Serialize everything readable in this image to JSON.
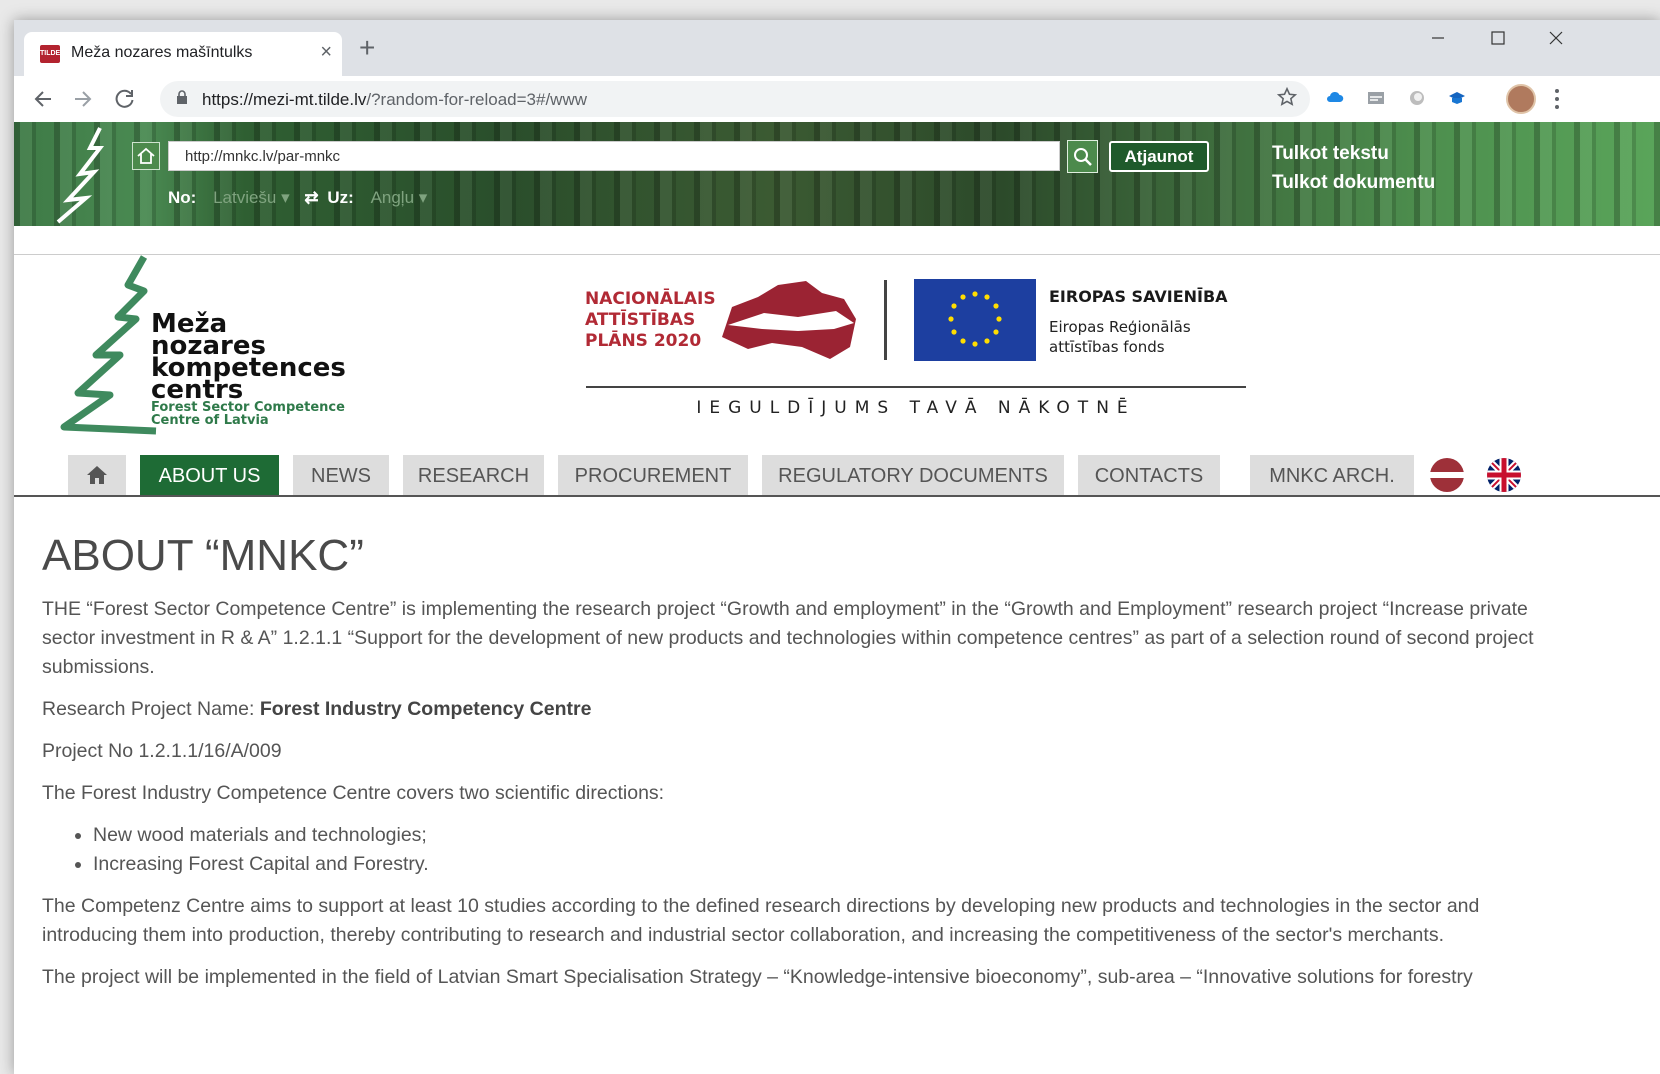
{
  "browser": {
    "tab_title": "Meža nozares mašīntulks",
    "tab_close": "×",
    "new_tab": "+",
    "url_host": "https://mezi-mt.tilde.lv",
    "url_path": "/?random-for-reload=3#/www"
  },
  "translator": {
    "url_value": "http://mnkc.lv/par-mnkc",
    "refresh_label": "Atjaunot",
    "translate_text": "Tulkot tekstu",
    "translate_doc": "Tulkot dokumentu",
    "from_label": "No:",
    "from_lang": "Latviešu",
    "to_label": "Uz:",
    "to_lang": "Angļu"
  },
  "header": {
    "logo_lines": [
      "Meža",
      "nozares",
      "kompetences",
      "centrs"
    ],
    "logo_sub": [
      "Forest Sector Competence",
      "Centre of Latvia"
    ],
    "nap_lines": [
      "NACIONĀLAIS",
      "ATTĪSTĪBAS",
      "PLĀNS 2020"
    ],
    "eu_title": "EIROPAS SAVIENĪBA",
    "eu_sub": [
      "Eiropas Reģionālās",
      "attīstības fonds"
    ],
    "motto": "IEGULDĪJUMS TAVĀ NĀKOTNĒ"
  },
  "nav": {
    "items": [
      "ABOUT US",
      "NEWS",
      "RESEARCH",
      "PROCUREMENT",
      "REGULATORY DOCUMENTS",
      "CONTACTS",
      "MNKC ARCH."
    ]
  },
  "content": {
    "heading": "ABOUT “MNKC”",
    "intro": "THE “Forest Sector Competence Centre” is implementing the research project “Growth and employment” in the “Growth and Employment” research project “Increase private sector investment in R & A” 1.2.1.1 “Support for the development of new products and technologies within competence centres” as part of a selection round of second project submissions.",
    "project_name_label": "Research Project Name:",
    "project_name_value": "Forest Industry Competency Centre",
    "project_no": "Project No 1.2.1.1/16/A/009",
    "directions_intro": "The Forest Industry Competence Centre covers two scientific directions:",
    "directions": [
      "New wood materials and technologies;",
      "Increasing Forest Capital and Forestry."
    ],
    "aims": "The Competenz Centre aims to support at least 10 studies according to the defined research directions by developing new products and technologies in the sector and introducing them into production, thereby contributing to research and industrial sector collaboration, and increasing the competitiveness of the sector's merchants.",
    "last": "The project will be implemented in the field of Latvian Smart Specialisation Strategy – “Knowledge-intensive bioeconomy”, sub-area – “Innovative solutions for forestry"
  },
  "colors": {
    "nav_active": "#1e6b35",
    "nap_red": "#b12a35",
    "eu_blue": "#1d3fa0"
  }
}
